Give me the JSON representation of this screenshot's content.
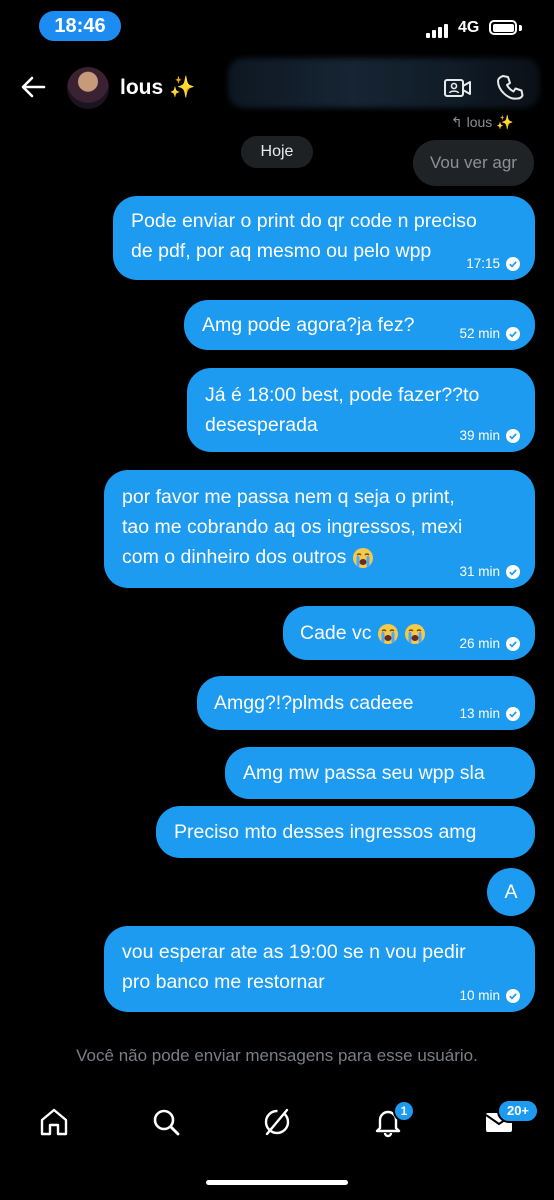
{
  "status_bar": {
    "time": "18:46",
    "network": "4G"
  },
  "header": {
    "contact_name": "lous ✨"
  },
  "reply_context": {
    "label": "↰ lous ✨",
    "text": "Vou ver agr"
  },
  "date_divider": "Hoje",
  "messages": [
    {
      "text": "Pode enviar o print do qr code n preciso\nde pdf, por aq mesmo ou pelo wpp",
      "time": "17:15"
    },
    {
      "text": "Amg pode agora?ja fez?",
      "time": "52 min"
    },
    {
      "text": "Já é 18:00 best, pode fazer??to\ndesesperada",
      "time": "39 min"
    },
    {
      "text": "por favor me passa nem q seja o print,\ntao me cobrando aq os ingressos, mexi\ncom o dinheiro dos outros",
      "time": "31 min"
    },
    {
      "text": "Cade vc",
      "time": "26 min"
    },
    {
      "text": "Amgg?!?plmds cadeee",
      "time": "13 min"
    },
    {
      "text": "Amg mw passa seu wpp sla",
      "time": ""
    },
    {
      "text": "Preciso mto desses ingressos amg",
      "time": ""
    },
    {
      "text": "A",
      "time": ""
    },
    {
      "text": "vou esperar ate as 19:00 se n vou pedir\npro banco me restornar",
      "time": "10 min"
    }
  ],
  "composer_notice": "Você não pode enviar mensagens para esse usuário.",
  "tab_bar": {
    "notifications_badge": "1",
    "messages_badge": "20+",
    "icons": [
      "home-icon",
      "search-icon",
      "grok-icon",
      "bell-icon",
      "mail-icon"
    ]
  },
  "colors": {
    "bubble": "#1d9bf0",
    "background": "#000000",
    "time_pill": "#1d8cf2"
  }
}
